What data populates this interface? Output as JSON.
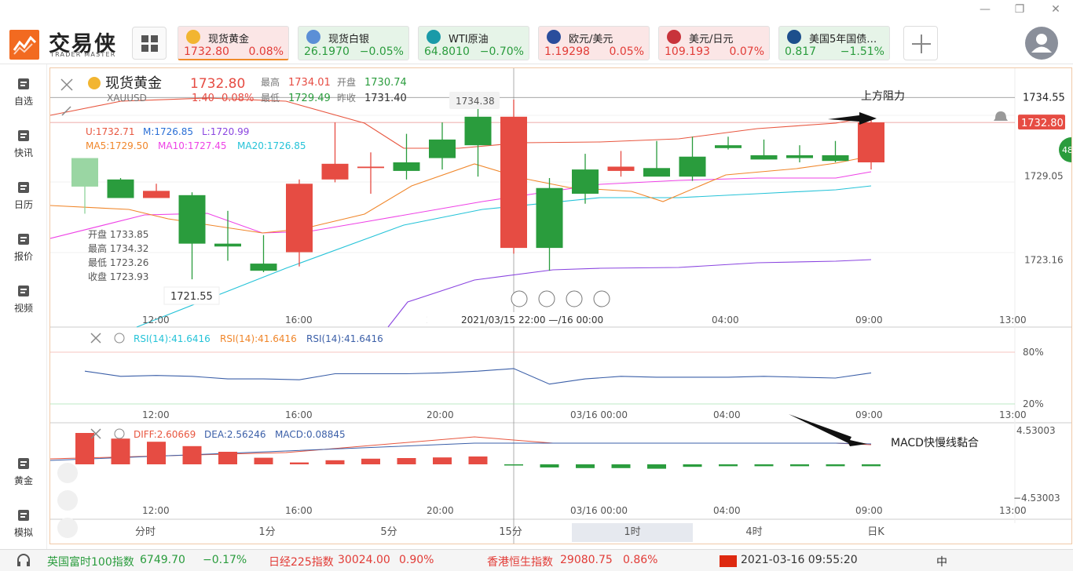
{
  "app": {
    "name": "交易侠",
    "sub": "TRADER MASTER"
  },
  "window": {
    "min": "—",
    "restore": "❐",
    "close": "✕"
  },
  "quotes": [
    {
      "name": "现货黄金",
      "price": "1732.80",
      "change": "0.08%",
      "dir": "up",
      "selected": true,
      "icon_color": "#f2b531"
    },
    {
      "name": "现货白银",
      "price": "26.1970",
      "change": "−0.05%",
      "dir": "down",
      "icon_color": "#5b8fd6"
    },
    {
      "name": "WTI原油",
      "price": "64.8010",
      "change": "−0.70%",
      "dir": "down",
      "icon_color": "#1a9aa8"
    },
    {
      "name": "欧元/美元",
      "price": "1.19298",
      "change": "0.05%",
      "dir": "up",
      "icon_color": "#2a4d9c"
    },
    {
      "name": "美元/日元",
      "price": "109.193",
      "change": "0.07%",
      "dir": "up",
      "icon_color": "#c8333b"
    },
    {
      "name": "美国5年国债…",
      "price": "0.817",
      "change": "−1.51%",
      "dir": "down",
      "icon_color": "#1d4f8c"
    }
  ],
  "sidebar": [
    {
      "label": "自选",
      "icon": "bookmark-icon"
    },
    {
      "label": "快讯",
      "icon": "news-icon"
    },
    {
      "label": "日历",
      "icon": "calendar-icon"
    },
    {
      "label": "报价",
      "icon": "chart-line-icon"
    },
    {
      "label": "视频",
      "icon": "video-icon"
    },
    {
      "label": "黄金",
      "icon": "gold-icon"
    },
    {
      "label": "模拟",
      "icon": "wallet-icon"
    }
  ],
  "header": {
    "symbol_name": "现货黄金",
    "symbol_code": "XAUUSD",
    "price": "1732.80",
    "change": "1.40",
    "change_pct": "0.08%",
    "high_label": "最高",
    "high": "1734.01",
    "open_label": "开盘",
    "open": "1730.74",
    "low_label": "最低",
    "low": "1729.49",
    "prev_label": "昨收",
    "prev": "1731.40"
  },
  "indicators": {
    "boll": {
      "u": "U:1732.71",
      "m": "M:1726.85",
      "l": "L:1720.99"
    },
    "ma": {
      "ma5": "MA5:1729.50",
      "ma10": "MA10:1727.45",
      "ma20": "MA20:1726.85"
    },
    "rsi": [
      "RSI(14):41.6416",
      "RSI(14):41.6416",
      "RSI(14):41.6416"
    ],
    "macd": {
      "diff": "DIFF:2.60669",
      "dea": "DEA:2.56246",
      "macd": "MACD:0.08845"
    }
  },
  "tooltip": {
    "open_label": "开盘",
    "open": "1733.85",
    "high_label": "最高",
    "high": "1734.32",
    "low_label": "最低",
    "low": "1723.26",
    "close_label": "收盘",
    "close": "1723.93"
  },
  "annotations": {
    "resistance": "上方阻力",
    "macd_note": "MACD快慢线黏合"
  },
  "price_axis": {
    "top": "1734.55",
    "current": "1732.80",
    "mid": "1729.05",
    "low": "1723.16",
    "peak": "1734.38",
    "trough": "1721.55"
  },
  "rsi_axis": [
    "80%",
    "20%"
  ],
  "macd_axis": [
    "4.53003",
    "−4.53003"
  ],
  "time_axis": [
    "12:00",
    "16:00",
    "20:00",
    "04:00",
    "09:00",
    "13:00"
  ],
  "crosshair_time": "2021/03/15 22:00 —/16 00:00",
  "time_axis_2": [
    "12:00",
    "16:00",
    "20:00",
    "03/16 00:00",
    "04:00",
    "09:00",
    "13:00"
  ],
  "timeframes": [
    "分时",
    "1分",
    "5分",
    "15分",
    "1时",
    "4时",
    "日K"
  ],
  "active_timeframe": "1时",
  "badge": "48",
  "chart_data": {
    "type": "candlestick",
    "candles": [
      {
        "o": 1728.3,
        "h": 1730.3,
        "l": 1726.4,
        "c": 1730.3
      },
      {
        "o": 1728.8,
        "h": 1728.9,
        "l": 1727.9,
        "c": 1727.5
      },
      {
        "o": 1727.5,
        "h": 1728.5,
        "l": 1727.6,
        "c": 1728.0
      },
      {
        "o": 1727.7,
        "h": 1727.9,
        "l": 1721.8,
        "c": 1724.3
      },
      {
        "o": 1724.3,
        "h": 1726.6,
        "l": 1723.1,
        "c": 1724.1
      },
      {
        "o": 1722.9,
        "h": 1724.9,
        "l": 1722.3,
        "c": 1722.4
      },
      {
        "o": 1723.7,
        "h": 1728.8,
        "l": 1722.7,
        "c": 1728.5
      },
      {
        "o": 1728.8,
        "h": 1732.8,
        "l": 1728.6,
        "c": 1729.9
      },
      {
        "o": 1729.6,
        "h": 1730.7,
        "l": 1727.8,
        "c": 1729.7
      },
      {
        "o": 1730.0,
        "h": 1732.0,
        "l": 1728.8,
        "c": 1729.4
      },
      {
        "o": 1731.6,
        "h": 1732.8,
        "l": 1729.5,
        "c": 1730.3
      },
      {
        "o": 1733.2,
        "h": 1734.4,
        "l": 1729.0,
        "c": 1731.2
      },
      {
        "o": 1724.0,
        "h": 1734.4,
        "l": 1723.6,
        "c": 1733.2
      },
      {
        "o": 1728.2,
        "h": 1728.9,
        "l": 1722.4,
        "c": 1724.0
      },
      {
        "o": 1729.5,
        "h": 1730.6,
        "l": 1727.1,
        "c": 1727.8
      },
      {
        "o": 1729.4,
        "h": 1730.8,
        "l": 1729.0,
        "c": 1729.7
      },
      {
        "o": 1729.6,
        "h": 1731.5,
        "l": 1729.3,
        "c": 1729.0
      },
      {
        "o": 1730.4,
        "h": 1731.8,
        "l": 1728.7,
        "c": 1729.0
      },
      {
        "o": 1731.2,
        "h": 1731.8,
        "l": 1730.9,
        "c": 1731.0
      },
      {
        "o": 1730.5,
        "h": 1731.6,
        "l": 1730.2,
        "c": 1730.2
      },
      {
        "o": 1730.5,
        "h": 1731.2,
        "l": 1730.0,
        "c": 1730.3
      },
      {
        "o": 1730.5,
        "h": 1731.5,
        "l": 1730.0,
        "c": 1730.1
      },
      {
        "o": 1730.0,
        "h": 1733.2,
        "l": 1729.5,
        "c": 1732.8
      }
    ],
    "rsi": [
      58,
      52,
      53,
      52,
      49,
      49,
      48,
      55,
      55,
      55,
      56,
      58,
      61,
      43,
      49,
      52,
      51,
      51,
      51,
      52,
      51,
      50,
      56
    ],
    "macd_hist": [
      1.0,
      0.82,
      0.72,
      0.58,
      0.4,
      0.21,
      0.06,
      0.13,
      0.18,
      0.2,
      0.22,
      0.25,
      -0.02,
      -0.1,
      -0.12,
      -0.12,
      -0.14,
      -0.08,
      -0.06,
      -0.06,
      -0.06,
      -0.06,
      -0.06
    ]
  }
}
